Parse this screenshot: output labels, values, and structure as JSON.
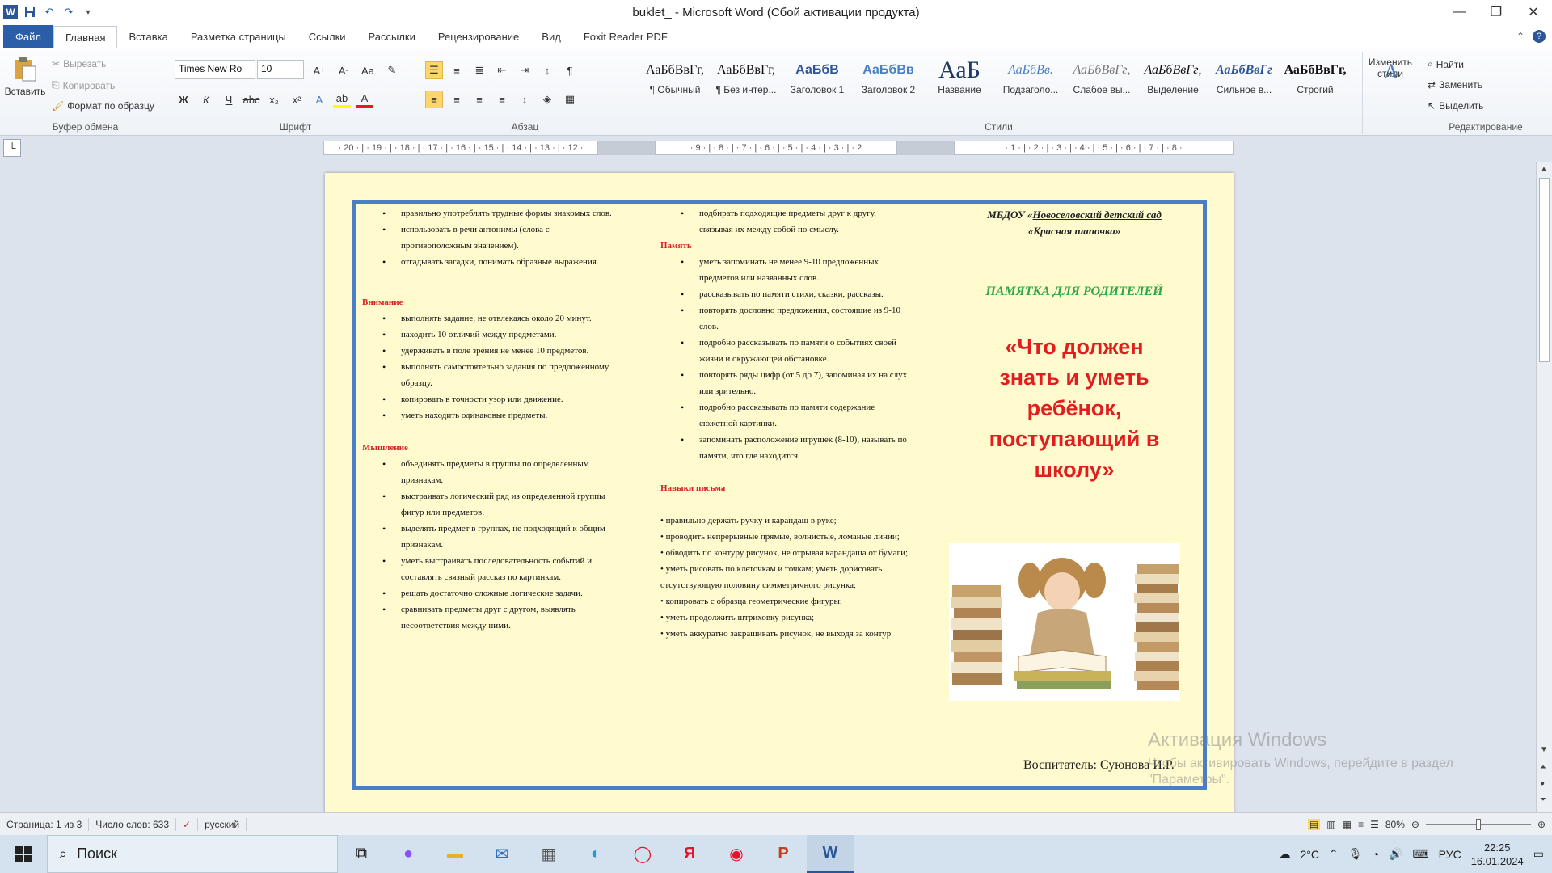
{
  "titlebar": {
    "title": "buklet_  - Microsoft Word (Сбой активации продукта)",
    "qat_icons": [
      "word-logo-icon",
      "save-icon",
      "undo-icon",
      "redo-icon",
      "customize-icon"
    ]
  },
  "tabs": [
    "Файл",
    "Главная",
    "Вставка",
    "Разметка страницы",
    "Ссылки",
    "Рассылки",
    "Рецензирование",
    "Вид",
    "Foxit Reader PDF"
  ],
  "clipboard": {
    "paste": "Вставить",
    "cut": "Вырезать",
    "copy": "Копировать",
    "format_painter": "Формат по образцу",
    "label": "Буфер обмена"
  },
  "font": {
    "name": "Times New Ro",
    "size": "10",
    "label": "Шрифт"
  },
  "paragraph": {
    "label": "Абзац"
  },
  "styles": {
    "label": "Стили",
    "items": [
      {
        "preview": "АаБбВвГг,",
        "name": "¶ Обычный",
        "color": "#111111"
      },
      {
        "preview": "АаБбВвГг,",
        "name": "¶ Без интер...",
        "color": "#111111"
      },
      {
        "preview": "АаБбВ",
        "name": "Заголовок 1",
        "color": "#2f5597"
      },
      {
        "preview": "АаБбВв",
        "name": "Заголовок 2",
        "color": "#4a7fc7"
      },
      {
        "preview": "АаБ",
        "name": "Название",
        "color": "#1f3864"
      },
      {
        "preview": "АаБбВв.",
        "name": "Подзаголо...",
        "color": "#4a7fc7"
      },
      {
        "preview": "АаБбВвГг,",
        "name": "Слабое вы...",
        "color": "#777777"
      },
      {
        "preview": "АаБбВвГг,",
        "name": "Выделение",
        "color": "#111111"
      },
      {
        "preview": "АаБбВвГг",
        "name": "Сильное в...",
        "color": "#2f5597"
      },
      {
        "preview": "АаБбВвГг,",
        "name": "Строгий",
        "color": "#111111"
      }
    ],
    "change_styles": "Изменить стили"
  },
  "editing": {
    "label": "Редактирование",
    "find": "Найти",
    "replace": "Заменить",
    "select": "Выделить"
  },
  "ruler": {
    "left_ticks": "· 20 · | · 19 · | · 18 · | · 17 · | · 16 · | · 15 · | · 14 · | · 13 · | · 12 ·",
    "mid_ticks": "· 9 · | · 8 · | · 7 · | · 6 · | · 5 · | · 4 · | · 3 · | · 2",
    "right_ticks": "· 1 · | · 2 · | · 3 · | · 4 · | · 5 · | · 6 · | · 7 · | · 8 ·"
  },
  "document": {
    "col1": {
      "intro": [
        "правильно употреблять трудные формы знакомых слов.",
        "использовать в речи антонимы (слова с противоположным значением).",
        "отгадывать загадки, понимать образные выражения."
      ],
      "attention_title": "Внимание",
      "attention": [
        "выполнять задание, не отвлекаясь около 20 минут.",
        "находить 10 отличий между предметами.",
        "удерживать в поле зрения не менее 10 предметов.",
        "выполнять самостоятельно задания по предложенному образцу.",
        "копировать в точности узор или движение.",
        "уметь находить одинаковые предметы."
      ],
      "thinking_title": "Мышление",
      "thinking": [
        "объединять предметы в группы по определенным признакам.",
        "выстраивать логический ряд из определенной группы фигур или предметов.",
        "выделять предмет в группах, не подходящий к общим признакам.",
        "уметь выстраивать последовательность событий и составлять связный рассказ по картинкам.",
        "решать достаточно сложные логические задачи.",
        "сравнивать предметы  друг с другом, выявлять несоответствия между ними."
      ]
    },
    "col2": {
      "intro": [
        "подбирать подходящие предметы друг к другу, связывая их между собой по смыслу."
      ],
      "memory_title": "Память",
      "memory": [
        "уметь запоминать не менее 9-10 предложенных предметов или названных слов.",
        "рассказывать по памяти стихи, сказки, рассказы.",
        "повторять дословно предложения, состоящие из 9-10 слов.",
        "подробно рассказывать по памяти о событиях своей жизни и окружающей обстановке.",
        "повторять ряды цифр (от 5 до 7), запоминая их на слух или зрительно.",
        "подробно рассказывать по памяти содержание сюжетной картинки.",
        "запоминать расположение игрушек (8-10), называть по памяти, что где находится."
      ],
      "writing_title": "Навыки письма",
      "writing": [
        "• правильно держать ручку и карандаш в руке;",
        "• проводить непрерывные прямые, волнистые, ломаные линии;",
        "• обводить по контуру рисунок, не отрывая карандаша от бумаги;",
        "• уметь рисовать по клеточкам и точкам; уметь дорисовать отсутствующую половину симметричного рисунка;",
        "• копировать с образца геометрические фигуры;",
        "• уметь продолжить штриховку рисунка;",
        "• уметь аккуратно закрашивать рисунок, не выходя за контур"
      ]
    },
    "col3": {
      "org_line1": "МБДОУ «",
      "org_name": "Новоселовский детский сад",
      "org_line2": "«Красная шапочка»",
      "memo": "ПАМЯТКА ДЛЯ РОДИТЕЛЕЙ",
      "title_lines": [
        "«Что должен",
        "знать и уметь",
        "ребёнок,",
        "поступающий в",
        "школу»"
      ],
      "teacher_label": "Воспитатель: ",
      "teacher_name": "Суюнова И.Р."
    }
  },
  "watermark": {
    "line1": "Активация Windows",
    "line2": "Чтобы активировать Windows, перейдите в раздел",
    "line3": "\"Параметры\"."
  },
  "statusbar": {
    "page": "Страница: 1 из 3",
    "words": "Число слов: 633",
    "language": "русский",
    "zoom": "80%"
  },
  "taskbar": {
    "search": "Поиск",
    "weather": "2°C",
    "lang": "РУС",
    "time": "22:25",
    "date": "16.01.2024"
  },
  "colors": {
    "page_bg": "#fffbcf",
    "frame": "#4a7fc7",
    "heading_red": "#d42222",
    "memo_green": "#2ea84a"
  }
}
